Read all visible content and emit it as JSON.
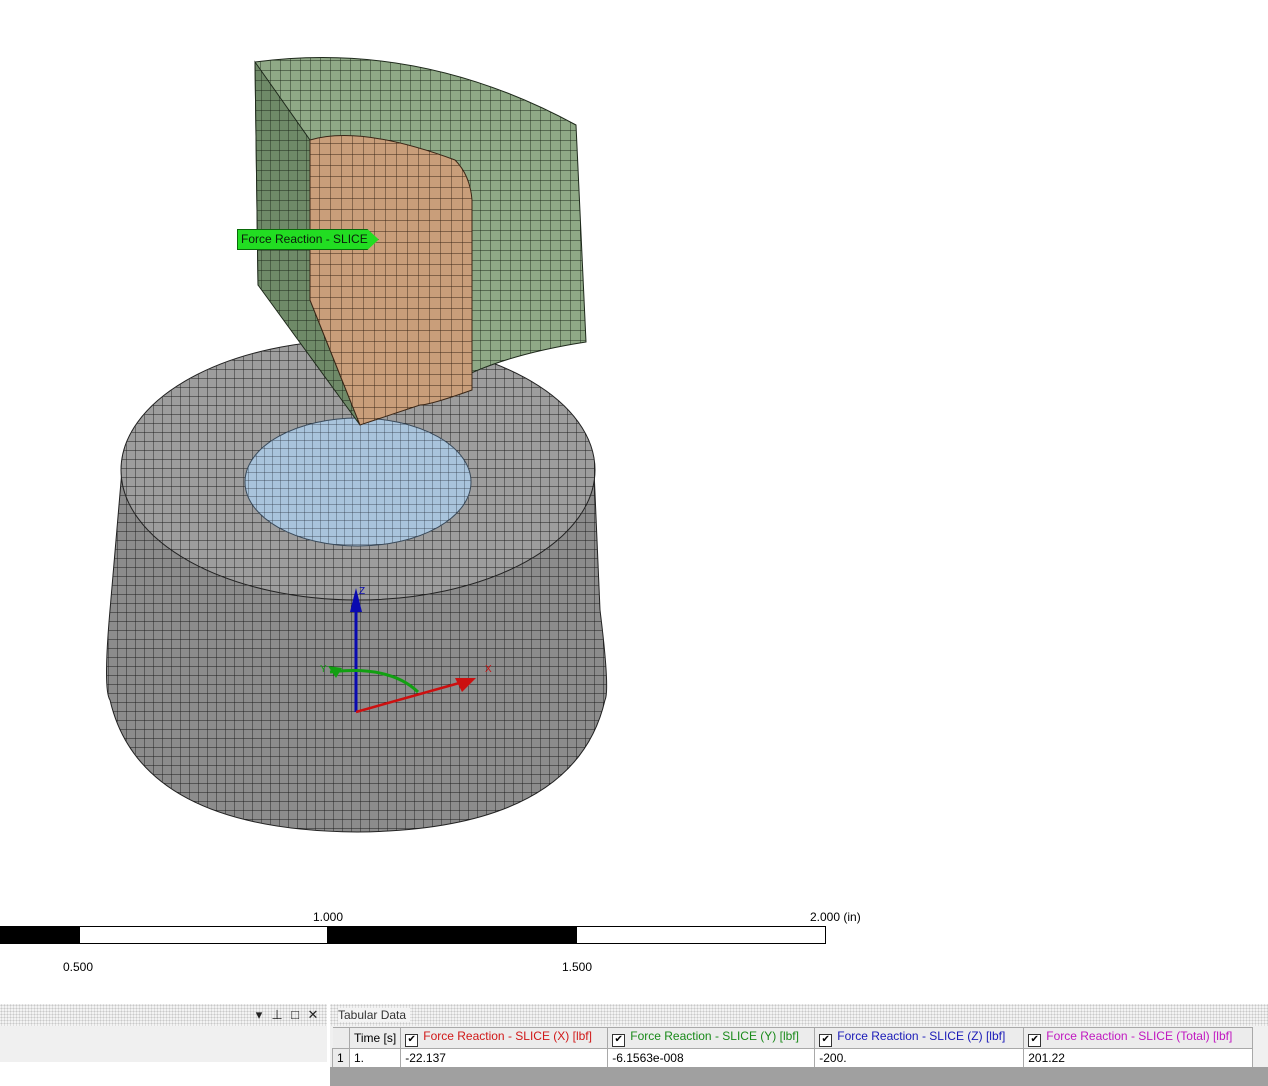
{
  "viewport": {
    "probe_label": "Force Reaction - SLICE",
    "triad": {
      "x": "X",
      "y": "Y",
      "z": "Z"
    },
    "colors": {
      "probe": "#22dd22",
      "top_part": "#8fa986",
      "core": "#c99e7a",
      "base": "#9e9e9e",
      "contact": "#a9c4dc"
    }
  },
  "scale_bar": {
    "top_labels": [
      "1.000",
      "2.000 (in)"
    ],
    "bottom_labels": [
      "0.500",
      "1.500"
    ]
  },
  "left_pane": {
    "buttons": [
      "▾",
      "⊥",
      "□",
      "✕"
    ]
  },
  "tabular": {
    "title": "Tabular Data",
    "columns": [
      {
        "label": "Time [s]",
        "checkbox": false,
        "color": "#000000"
      },
      {
        "label": "Force Reaction - SLICE (X) [lbf]",
        "checkbox": true,
        "color": "#d01818"
      },
      {
        "label": "Force Reaction - SLICE (Y) [lbf]",
        "checkbox": true,
        "color": "#1a8a1a"
      },
      {
        "label": "Force Reaction - SLICE (Z) [lbf]",
        "checkbox": true,
        "color": "#1a1ab8"
      },
      {
        "label": "Force Reaction - SLICE (Total) [lbf]",
        "checkbox": true,
        "color": "#c018c0"
      }
    ],
    "rows": [
      {
        "index": "1",
        "cells": [
          "1.",
          "-22.137",
          "-6.1563e-008",
          "-200.",
          "201.22"
        ]
      }
    ]
  }
}
